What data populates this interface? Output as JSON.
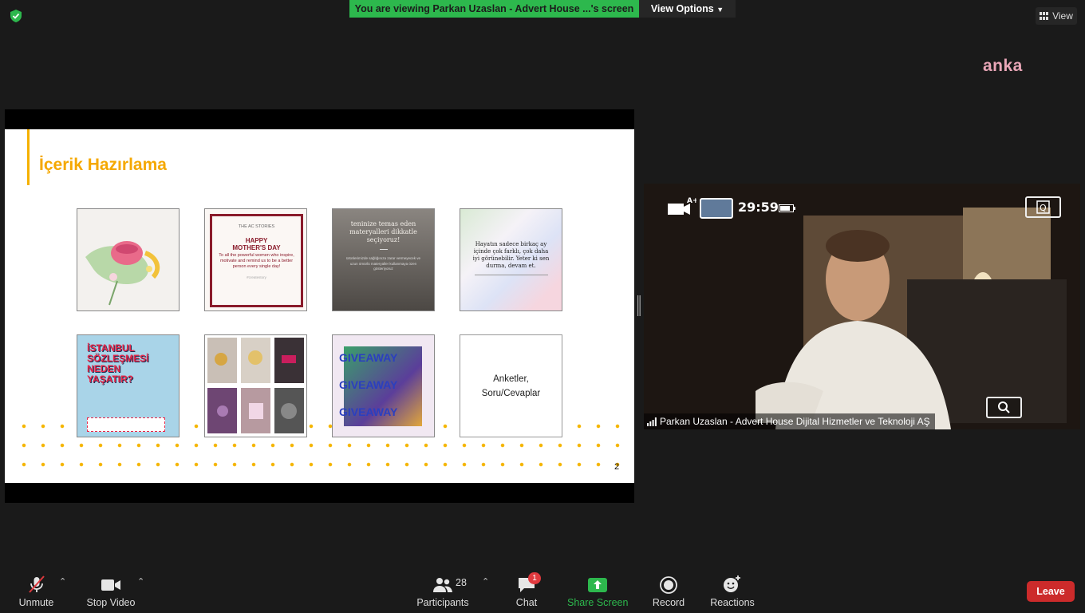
{
  "top_bar": {
    "share_banner": "You are viewing Parkan Uzaslan - Advert House ...'s screen",
    "view_options": "View Options",
    "view": "View",
    "watermark": "anka"
  },
  "slide": {
    "title": "İçerik Hazırlama",
    "number": "2",
    "thumbnails": [
      {
        "id": "hands-cup",
        "text": ""
      },
      {
        "id": "mothers-day",
        "brand": "THE AC STORIES",
        "heading": "HAPPY MOTHER'S DAY",
        "body": "To all the powerful women who inspire, motivate and remind us to be a better person every single day!",
        "tag": "#createstory"
      },
      {
        "id": "materials",
        "heading": "teninize temas eden materyalleri dikkatle seçiyoruz!",
        "body": "ürünlerimizde sağlığınıza zarar vermeyecek ve uzun ömürlü materyaller kullanmaya özen gösteriyoruz"
      },
      {
        "id": "quote",
        "body": "Hayatın sadece birkaç ay içinde çok farklı, çok daha iyi görünebilir. Yeter ki sen durma, devam et."
      },
      {
        "id": "istanbul",
        "heading": "İSTANBUL SÖZLEŞMESİ NEDEN YAŞATIR?"
      },
      {
        "id": "jewelry-grid",
        "text": ""
      },
      {
        "id": "giveaway",
        "heading": "GIVEAWAY"
      },
      {
        "id": "surveys",
        "line1": "Anketler,",
        "line2": "Soru/Cevaplar"
      }
    ]
  },
  "video": {
    "participant_name": "Parkan Uzaslan - Advert House Dijital Hizmetler ve Teknoloji AŞ",
    "camera_time": "29:59"
  },
  "toolbar": {
    "unmute": "Unmute",
    "stop_video": "Stop Video",
    "participants": "Participants",
    "participants_count": "28",
    "chat": "Chat",
    "chat_badge": "1",
    "share_screen": "Share Screen",
    "record": "Record",
    "reactions": "Reactions",
    "leave": "Leave"
  },
  "colors": {
    "share_green": "#2db84d",
    "slide_accent": "#f5a800",
    "leave_red": "#cc2b2b"
  }
}
